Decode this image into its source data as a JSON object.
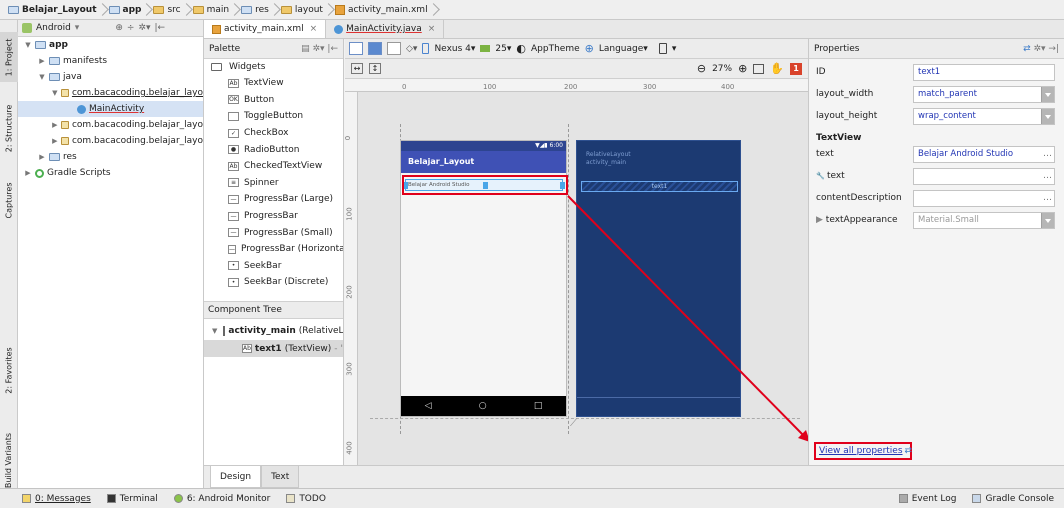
{
  "breadcrumb": [
    "Belajar_Layout",
    "app",
    "src",
    "main",
    "res",
    "layout",
    "activity_main.xml"
  ],
  "project_panel": {
    "view_mode": "Android",
    "tree": [
      {
        "label": "app",
        "level": 0,
        "icon": "module-folder-icon",
        "open": true,
        "bold": true
      },
      {
        "label": "manifests",
        "level": 1,
        "icon": "folder-icon",
        "open": false
      },
      {
        "label": "java",
        "level": 1,
        "icon": "folder-icon",
        "open": true
      },
      {
        "label": "com.bacacoding.belajar_layo",
        "level": 2,
        "icon": "package-icon",
        "open": true
      },
      {
        "label": "MainActivity",
        "level": 3,
        "icon": "class-icon",
        "open": null,
        "selected": true
      },
      {
        "label": "com.bacacoding.belajar_layo",
        "level": 2,
        "icon": "package-icon",
        "open": false
      },
      {
        "label": "com.bacacoding.belajar_layo",
        "level": 2,
        "icon": "package-icon",
        "open": false
      },
      {
        "label": "res",
        "level": 1,
        "icon": "folder-icon",
        "open": false
      },
      {
        "label": "Gradle Scripts",
        "level": 0,
        "icon": "gradle-icon",
        "open": false
      }
    ]
  },
  "left_tool_tabs": [
    "1: Project",
    "2: Structure",
    "Captures",
    "2: Favorites",
    "Build Variants"
  ],
  "editor_tabs": [
    {
      "label": "activity_main.xml",
      "active": true
    },
    {
      "label": "MainActivity.java",
      "active": false
    }
  ],
  "palette": {
    "title": "Palette",
    "group": "Widgets",
    "items": [
      {
        "label": "TextView",
        "icon": "Ab"
      },
      {
        "label": "Button",
        "icon": "OK"
      },
      {
        "label": "ToggleButton",
        "icon": ""
      },
      {
        "label": "CheckBox",
        "icon": "✓"
      },
      {
        "label": "RadioButton",
        "icon": "●"
      },
      {
        "label": "CheckedTextView",
        "icon": "Ab"
      },
      {
        "label": "Spinner",
        "icon": "≡"
      },
      {
        "label": "ProgressBar (Large)",
        "icon": "—"
      },
      {
        "label": "ProgressBar",
        "icon": "—"
      },
      {
        "label": "ProgressBar (Small)",
        "icon": "—"
      },
      {
        "label": "ProgressBar (Horizontal)",
        "icon": "—"
      },
      {
        "label": "SeekBar",
        "icon": "•"
      },
      {
        "label": "SeekBar (Discrete)",
        "icon": "•"
      }
    ]
  },
  "component_tree": {
    "title": "Component Tree",
    "root": "activity_main",
    "root_type": "(RelativeL",
    "child": "text1",
    "child_type": "(TextView)",
    "child_extra": "- \"E"
  },
  "design_toolbar": {
    "device": "Nexus 4",
    "api": "25",
    "theme": "AppTheme",
    "language": "Language",
    "zoom": "27%"
  },
  "ruler": {
    "h": [
      "0",
      "100",
      "200",
      "300",
      "400"
    ],
    "v": [
      "0",
      "100",
      "200",
      "300",
      "400"
    ]
  },
  "phone": {
    "time": "6:00",
    "app_title": "Belajar_Layout",
    "textview_text": "Belajar Android Studio",
    "nav": [
      "◁",
      "○",
      "□"
    ]
  },
  "blueprint": {
    "line1": "RelativeLayout",
    "line2": "activity_main",
    "widget_label": "text1"
  },
  "properties": {
    "title": "Properties",
    "rows": [
      {
        "label": "ID",
        "value": "text1",
        "dropdown": false
      },
      {
        "label": "layout_width",
        "value": "match_parent",
        "dropdown": true
      },
      {
        "label": "layout_height",
        "value": "wrap_content",
        "dropdown": true
      }
    ],
    "section": "TextView",
    "rows2": [
      {
        "label": "text",
        "value": "Belajar Android Studio",
        "dropdown": false,
        "dots": true
      },
      {
        "label": "text",
        "value": "",
        "dropdown": false,
        "dots": true,
        "wrench": true
      },
      {
        "label": "contentDescription",
        "value": "",
        "dropdown": false,
        "dots": true
      },
      {
        "label": "textAppearance",
        "value": "Material.Small",
        "dropdown": true,
        "grey": true,
        "tri": true
      }
    ],
    "view_all": "View all properties"
  },
  "bottom_tabs": [
    {
      "label": "Design",
      "active": true
    },
    {
      "label": "Text",
      "active": false
    }
  ],
  "status_bar": {
    "left": [
      "0: Messages",
      "Terminal",
      "6: Android Monitor",
      "TODO"
    ],
    "right": [
      "Event Log",
      "Gradle Console"
    ]
  },
  "colors": {
    "highlight": "#e0001b",
    "primary": "#3f51b5",
    "blueprint": "#1c3a72",
    "link": "#2235b4"
  }
}
